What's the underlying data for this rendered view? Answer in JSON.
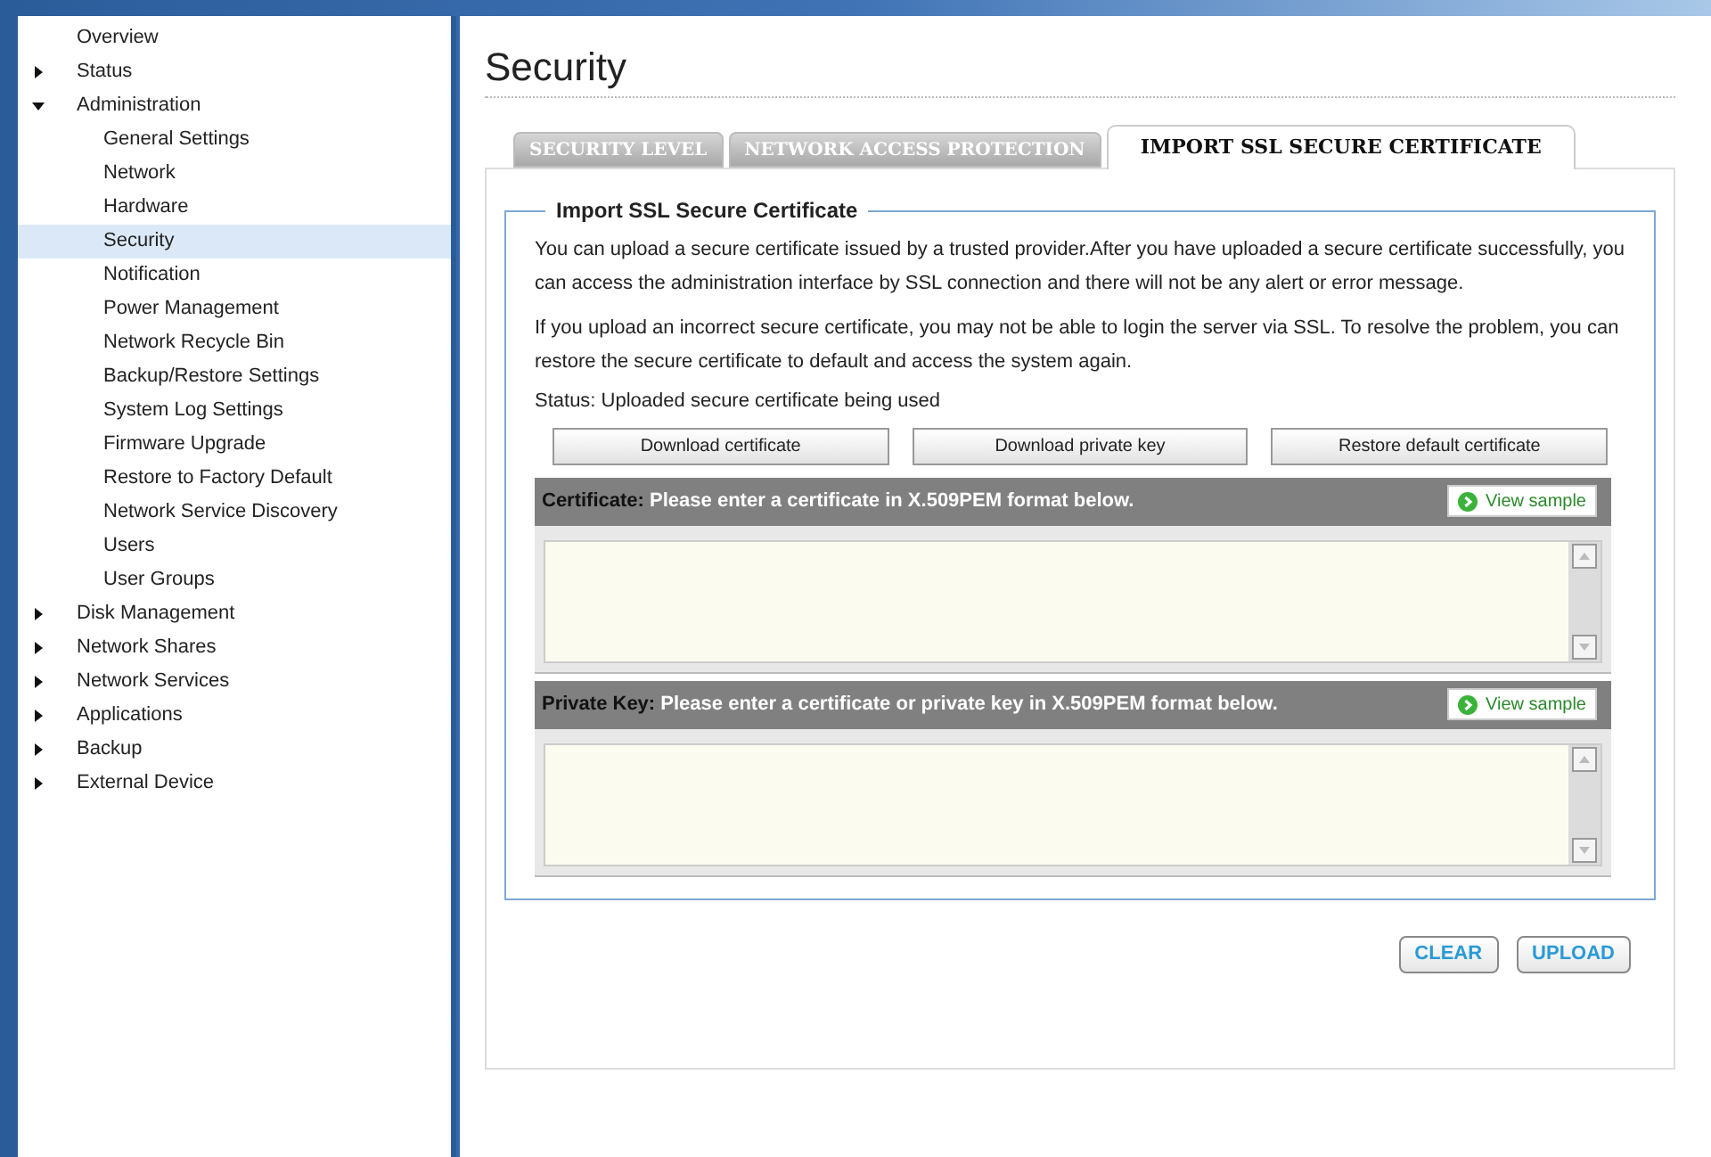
{
  "sidebar": {
    "items": [
      {
        "label": "Overview",
        "kind": "leaf",
        "selected": false
      },
      {
        "label": "Status",
        "kind": "folder",
        "expanded": false,
        "selected": false
      },
      {
        "label": "Administration",
        "kind": "folder",
        "expanded": true,
        "selected": false,
        "children": [
          {
            "label": "General Settings",
            "selected": false
          },
          {
            "label": "Network",
            "selected": false
          },
          {
            "label": "Hardware",
            "selected": false
          },
          {
            "label": "Security",
            "selected": true
          },
          {
            "label": "Notification",
            "selected": false
          },
          {
            "label": "Power Management",
            "selected": false
          },
          {
            "label": "Network Recycle Bin",
            "selected": false
          },
          {
            "label": "Backup/Restore Settings",
            "selected": false
          },
          {
            "label": "System Log Settings",
            "selected": false
          },
          {
            "label": "Firmware Upgrade",
            "selected": false
          },
          {
            "label": "Restore to Factory Default",
            "selected": false
          },
          {
            "label": "Network Service Discovery",
            "selected": false
          },
          {
            "label": "Users",
            "selected": false
          },
          {
            "label": "User Groups",
            "selected": false
          }
        ]
      },
      {
        "label": "Disk Management",
        "kind": "folder",
        "expanded": false,
        "selected": false
      },
      {
        "label": "Network Shares",
        "kind": "folder",
        "expanded": false,
        "selected": false
      },
      {
        "label": "Network Services",
        "kind": "folder",
        "expanded": false,
        "selected": false
      },
      {
        "label": "Applications",
        "kind": "folder",
        "expanded": false,
        "selected": false
      },
      {
        "label": "Backup",
        "kind": "folder",
        "expanded": false,
        "selected": false
      },
      {
        "label": "External Device",
        "kind": "folder",
        "expanded": false,
        "selected": false
      }
    ]
  },
  "page": {
    "title": "Security",
    "tabs": [
      {
        "label": "SECURITY LEVEL",
        "selected": false
      },
      {
        "label": "NETWORK ACCESS PROTECTION",
        "selected": false
      },
      {
        "label": "IMPORT SSL SECURE CERTIFICATE",
        "selected": true
      }
    ],
    "section": {
      "legend": "Import SSL Secure Certificate",
      "paragraphs": [
        "You can upload a secure certificate issued by a trusted provider.After you have uploaded a secure certificate successfully, you can access the administration interface by SSL connection and there will not be any alert or error message.",
        "If you upload an incorrect secure certificate, you may not be able to login the server via SSL. To resolve the problem, you can restore the secure certificate to default and access the system again."
      ],
      "status": "Status: Uploaded secure certificate being used",
      "buttons": [
        "Download certificate",
        "Download private key",
        "Restore default certificate"
      ],
      "inputs": [
        {
          "label": "Certificate:",
          "hint": "Please enter a certificate in X.509PEM format below.",
          "sample_button": "View sample"
        },
        {
          "label": "Private Key:",
          "hint": "Please enter a certificate or private key in X.509PEM format below.",
          "sample_button": "View sample"
        }
      ]
    },
    "actions": [
      "CLEAR",
      "UPLOAD"
    ]
  }
}
